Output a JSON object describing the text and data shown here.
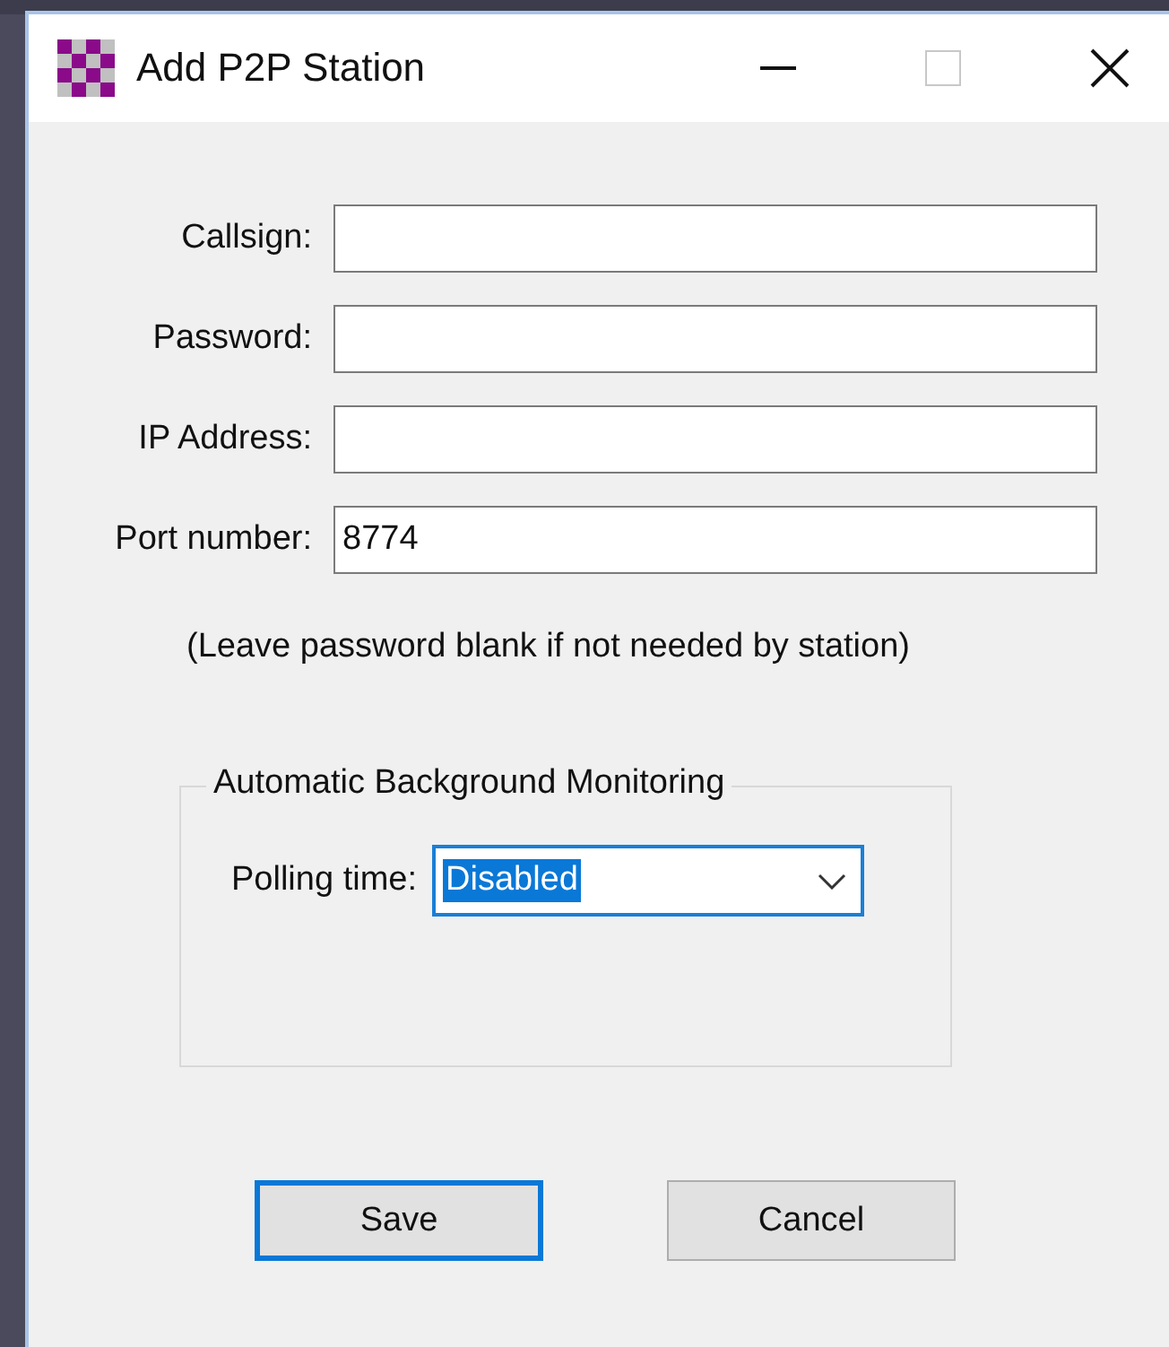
{
  "window": {
    "title": "Add P2P Station"
  },
  "fields": [
    {
      "label": "Callsign:"
    },
    {
      "label": "Password:"
    },
    {
      "label": "IP Address:"
    },
    {
      "label": "Port number:",
      "value": "8774"
    }
  ],
  "note": "(Leave password blank if not needed by station)",
  "monitoring": {
    "title": "Automatic Background Monitoring",
    "polling_label": "Polling time:",
    "polling_value": "Disabled",
    "focused": true
  },
  "buttons": [
    {
      "label": "Save",
      "default": true
    },
    {
      "label": "Cancel",
      "default": false
    }
  ]
}
